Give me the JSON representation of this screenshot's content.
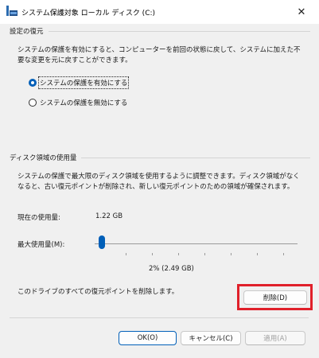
{
  "window": {
    "title": "システム保護対象 ローカル ディスク (C:)",
    "close": "✕"
  },
  "restore_settings": {
    "group_title": "設定の復元",
    "description": "システムの保護を有効にすると、コンピューターを前回の状態に戻して、システムに加えた不要な変更を元に戻すことができます。",
    "options": [
      {
        "label": "システムの保護を有効にする",
        "selected": true
      },
      {
        "label": "システムの保護を無効にする",
        "selected": false
      }
    ]
  },
  "disk_usage": {
    "group_title": "ディスク領域の使用量",
    "description": "システムの保護で最大限のディスク領域を使用するように調整できます。ディスク領域がなくなると、古い復元ポイントが削除され、新しい復元ポイントのための領域が確保されます。",
    "current_label": "現在の使用量:",
    "current_value": "1.22 GB",
    "max_label": "最大使用量(M):",
    "slider_percent": 2,
    "slider_value_text": "2% (2.49 GB)",
    "delete_text": "このドライブのすべての復元ポイントを削除します。",
    "delete_button": "削除(D)"
  },
  "footer": {
    "ok": "OK(O)",
    "cancel": "キャンセル(C)",
    "apply": "適用(A)"
  },
  "colors": {
    "accent": "#005fb8",
    "highlight": "#e0202a"
  }
}
